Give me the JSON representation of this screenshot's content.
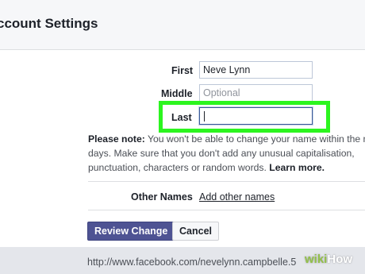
{
  "header": {
    "title": "ccount Settings"
  },
  "form": {
    "first": {
      "label": "First",
      "value": "Neve Lynn"
    },
    "middle": {
      "label": "Middle",
      "placeholder": "Optional"
    },
    "last": {
      "label": "Last",
      "value": ""
    }
  },
  "note": {
    "bold": "Please note:",
    "line1": " You won't be able to change your name within the n",
    "line2": "days. Make sure that you don't add any unusual capitalisation,",
    "line3_prefix": "punctuation, characters or random words. ",
    "learn_more": "Learn more."
  },
  "other_names": {
    "label": "Other Names",
    "link": "Add other names"
  },
  "buttons": {
    "review": "Review Change",
    "cancel": "Cancel"
  },
  "status_url": "http://www.facebook.com/nevelynn.campbelle.5",
  "watermark": {
    "w": "wiki",
    "h": "How"
  },
  "colors": {
    "highlight": "#2cf51f",
    "primary_button": "#4e5393"
  }
}
